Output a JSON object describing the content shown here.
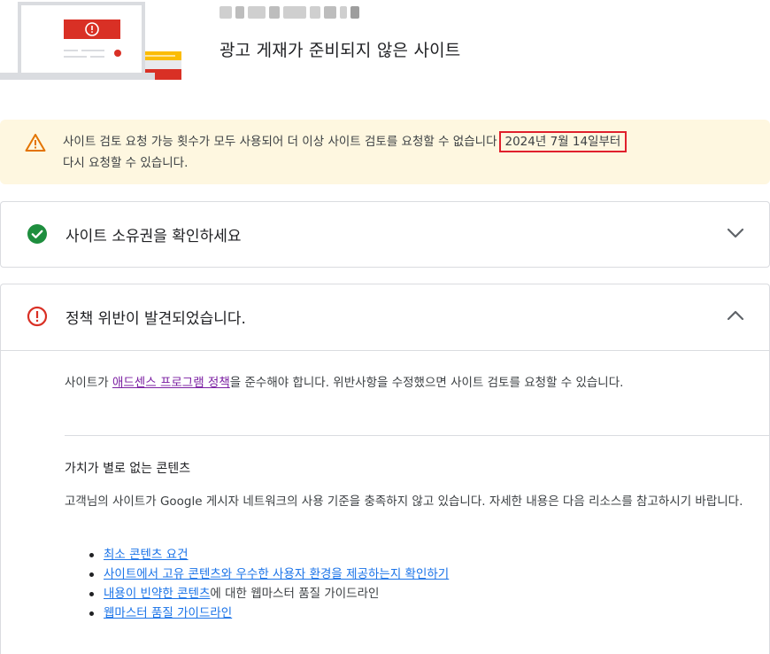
{
  "header": {
    "page_title": "광고 게재가 준비되지 않은 사이트"
  },
  "warning": {
    "icon": "warning-triangle-icon",
    "text_before": "사이트 검토 요청 가능 횟수가 모두 사용되어 더 이상 사이트 검토를 요청할 수 없습니다",
    "date": "2024년 7월 14일부터",
    "text_after": "다시 요청할 수 있습니다."
  },
  "ownership_card": {
    "icon": "check-circle-icon",
    "title": "사이트 소유권을 확인하세요",
    "expanded": false
  },
  "policy_card": {
    "icon": "error-circle-icon",
    "title": "정책 위반이 발견되었습니다.",
    "expanded": true,
    "intro_before": "사이트가 ",
    "intro_link": "애드센스 프로그램 정책",
    "intro_after": "을 준수해야 합니다. 위반사항을 수정했으면 사이트 검토를 요청할 수 있습니다.",
    "issue_title": "가치가 별로 없는 콘텐츠",
    "issue_desc": "고객님의 사이트가 Google 게시자 네트워크의 사용 기준을 충족하지 않고 있습니다. 자세한 내용은 다음 리소스를 참고하시기 바랍니다.",
    "resources": [
      {
        "link": "최소 콘텐츠 요건",
        "suffix": ""
      },
      {
        "link": "사이트에서 고유 콘텐츠와 우수한 사용자 환경을 제공하는지 확인하기",
        "suffix": ""
      },
      {
        "link": "내용이 빈약한 콘텐츠",
        "suffix": "에 대한 웹마스터 품질 가이드라인"
      },
      {
        "link": "웹마스터 품질 가이드라인",
        "suffix": ""
      }
    ]
  },
  "colors": {
    "warning_bg": "#fef7e0",
    "warning_icon": "#e37400",
    "success": "#1e8e3e",
    "error": "#d93025",
    "highlight_box": "#e0202c",
    "link_visited": "#7b1fa2",
    "link": "#1a73e8"
  }
}
